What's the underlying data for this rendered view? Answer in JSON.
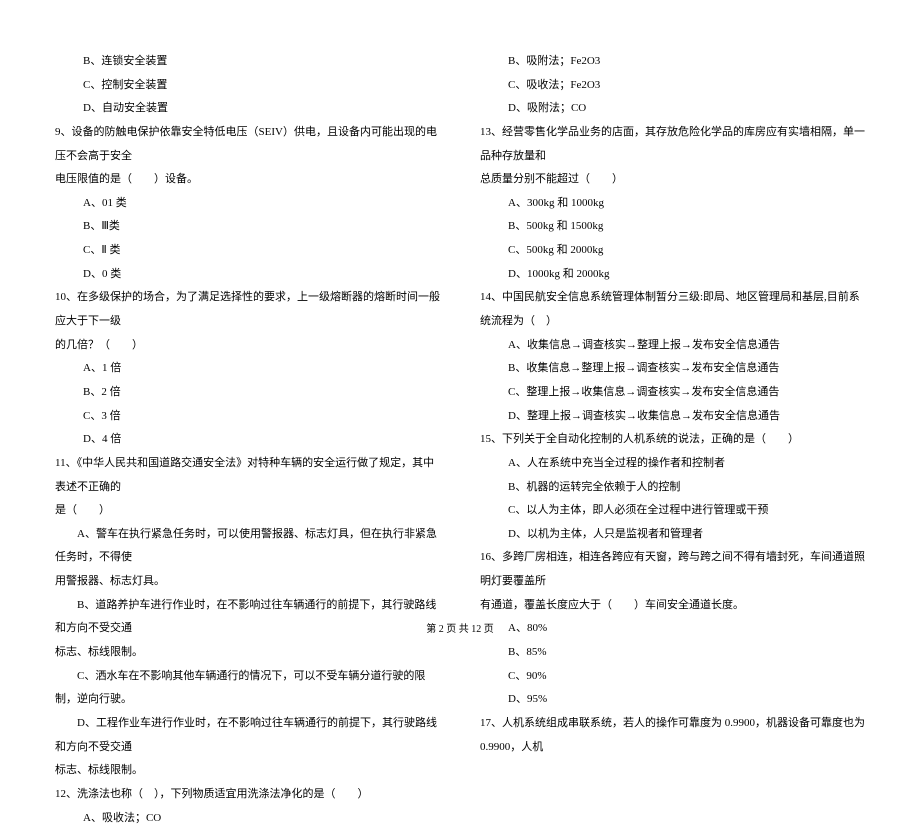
{
  "left": {
    "o1": "B、连锁安全装置",
    "o2": "C、控制安全装置",
    "o3": "D、自动安全装置",
    "q9_l1": "9、设备的防触电保护依靠安全特低电压（SEIV）供电，且设备内可能出现的电压不会高于安全",
    "q9_l2": "电压限值的是（　　）设备。",
    "q9_a": "A、01 类",
    "q9_b": "B、Ⅲ类",
    "q9_c": "C、Ⅱ 类",
    "q9_d": "D、0 类",
    "q10_l1": "10、在多级保护的场合，为了满足选择性的要求，上一级熔断器的熔断时间一般应大于下一级",
    "q10_l2": "的几倍？（　　）",
    "q10_a": "A、1 倍",
    "q10_b": "B、2 倍",
    "q10_c": "C、3 倍",
    "q10_d": "D、4 倍",
    "q11_l1": "11、《中华人民共和国道路交通安全法》对特种车辆的安全运行做了规定，其中表述不正确的",
    "q11_l2": "是（　　）",
    "q11_a_l1": "　　A、警车在执行紧急任务时，可以使用警报器、标志灯具，但在执行非紧急任务时，不得使",
    "q11_a_l2": "用警报器、标志灯具。",
    "q11_b_l1": "　　B、道路养护车进行作业时，在不影响过往车辆通行的前提下，其行驶路线和方向不受交通",
    "q11_b_l2": "标志、标线限制。",
    "q11_c": "　　C、洒水车在不影响其他车辆通行的情况下，可以不受车辆分道行驶的限制，逆向行驶。",
    "q11_d_l1": "　　D、工程作业车进行作业时，在不影响过往车辆通行的前提下，其行驶路线和方向不受交通",
    "q11_d_l2": "标志、标线限制。",
    "q12": "12、洗涤法也称（　），下列物质适宜用洗涤法净化的是（　　）",
    "q12_a": "A、吸收法；CO"
  },
  "right": {
    "o1": "B、吸附法；Fe2O3",
    "o2": "C、吸收法；Fe2O3",
    "o3": "D、吸附法；CO",
    "q13_l1": "13、经营零售化学品业务的店面，其存放危险化学品的库房应有实墙相隔，单一品种存放量和",
    "q13_l2": "总质量分别不能超过（　　）",
    "q13_a": "A、300kg 和 1000kg",
    "q13_b": "B、500kg 和 1500kg",
    "q13_c": "C、500kg 和 2000kg",
    "q13_d": "D、1000kg 和 2000kg",
    "q14": "14、中国民航安全信息系统管理体制暂分三级:即局、地区管理局和基层,目前系统流程为（　）",
    "q14_a": "A、收集信息→调查核实→整理上报→发布安全信息通告",
    "q14_b": "B、收集信息→整理上报→调查核实→发布安全信息通告",
    "q14_c": "C、整理上报→收集信息→调查核实→发布安全信息通告",
    "q14_d": "D、整理上报→调查核实→收集信息→发布安全信息通告",
    "q15": "15、下列关于全自动化控制的人机系统的说法，正确的是（　　）",
    "q15_a": "A、人在系统中充当全过程的操作者和控制者",
    "q15_b": "B、机器的运转完全依赖于人的控制",
    "q15_c": "C、以人为主体，即人必须在全过程中进行管理或干预",
    "q15_d": "D、以机为主体，人只是监视者和管理者",
    "q16_l1": "16、多跨厂房相连，相连各跨应有天窗，跨与跨之间不得有墙封死，车间通道照明灯要覆盖所",
    "q16_l2": "有通道，覆盖长度应大于（　　）车间安全通道长度。",
    "q16_a": "A、80%",
    "q16_b": "B、85%",
    "q16_c": "C、90%",
    "q16_d": "D、95%",
    "q17": "17、人机系统组成串联系统，若人的操作可靠度为 0.9900，机器设备可靠度也为 0.9900，人机"
  },
  "footer": "第 2 页 共 12 页"
}
